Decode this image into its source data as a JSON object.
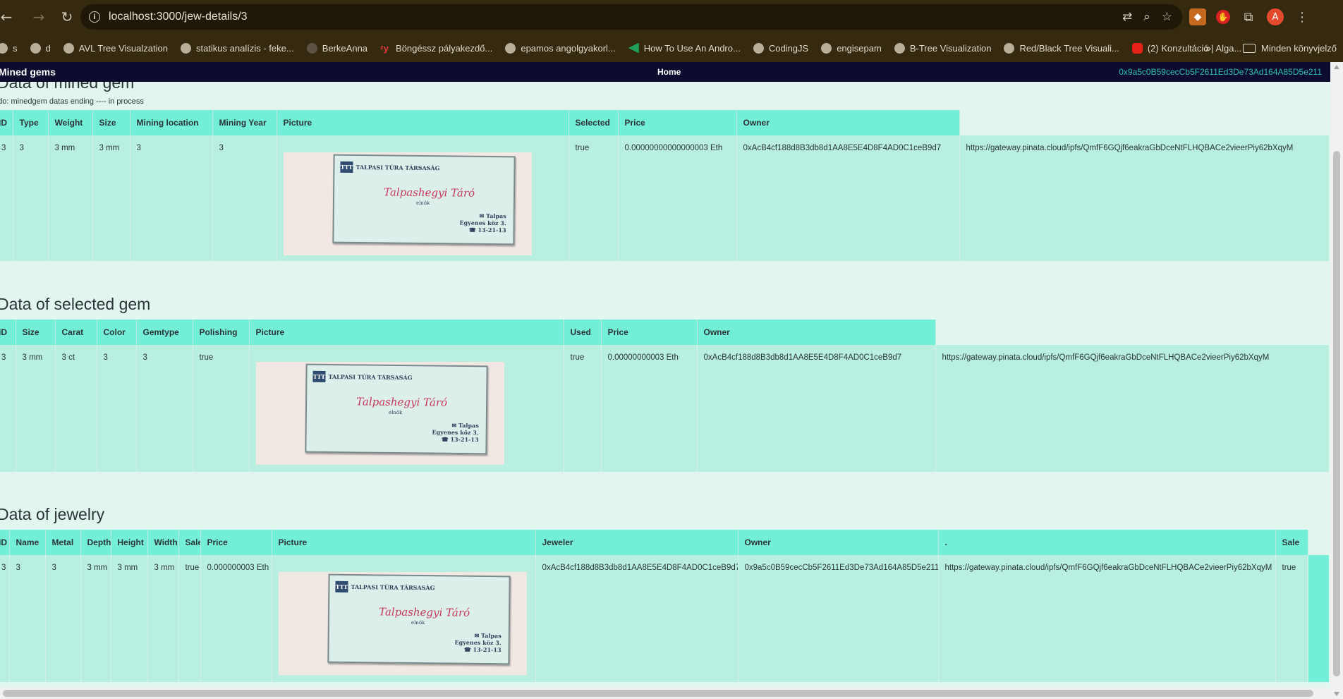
{
  "browser": {
    "url": "localhost:3000/jew-details/3",
    "bookmarks": [
      {
        "label": "s",
        "icon": "globe-icon"
      },
      {
        "label": "d",
        "icon": "globe-icon"
      },
      {
        "label": "AVL Tree Visualzation",
        "icon": "globe-icon"
      },
      {
        "label": "statikus analízis - feke...",
        "icon": "globe-icon"
      },
      {
        "label": "BerkeAnna",
        "icon": "github-icon"
      },
      {
        "label": "Böngéssz pályakezdő...",
        "icon": "zy-icon"
      },
      {
        "label": "epamos angolgyakorl...",
        "icon": "globe-icon"
      },
      {
        "label": "How To Use An Andro...",
        "icon": "arrow-icon"
      },
      {
        "label": "CodingJS",
        "icon": "globe-icon"
      },
      {
        "label": "engisepam",
        "icon": "globe-icon"
      },
      {
        "label": "B-Tree Visualization",
        "icon": "globe-icon"
      },
      {
        "label": "Red/Black Tree Visuali...",
        "icon": "globe-icon"
      },
      {
        "label": "(2) Konzultáció | Alga...",
        "icon": "youtube-icon"
      }
    ],
    "more_label": "»",
    "folder_label": "Minden könyvjelző",
    "avatar_letter": "A"
  },
  "navbar": {
    "brand": "Mined gems",
    "home": "Home",
    "account": "0x9a5c0B59cecCb5F2611Ed3De73Ad164A85D5e211"
  },
  "card_image": {
    "logo": "TTT",
    "org": "TALPASI TÚRA TÁRSASÁG",
    "name": "Talpashegyi Táró",
    "role": "elnök",
    "addr1": "✉ Talpas",
    "addr2": "Egyenes köz 3.",
    "addr3": "☎ 13-21-13"
  },
  "mined": {
    "title": "Data of mined gem",
    "note": "todo: minedgem datas ending ---- in process",
    "headers": [
      "ID",
      "Type",
      "Weight",
      "Size",
      "Mining location",
      "Mining Year",
      "Picture",
      "Selected",
      "Price",
      "Owner"
    ],
    "row": {
      "id": "3",
      "type": "3",
      "weight": "3 mm",
      "size": "3 mm",
      "location": "3",
      "year": "3",
      "selected": "true",
      "price": "0.00000000000000003 Eth",
      "owner": "0xAcB4cf188d8B3db8d1AA8E5E4D8F4AD0C1ceB9d7",
      "link": "https://gateway.pinata.cloud/ipfs/QmfF6GQjf6eakraGbDceNtFLHQBACe2vieerPiy62bXqyM"
    }
  },
  "selected": {
    "title": "Data of selected gem",
    "headers": [
      "ID",
      "Size",
      "Carat",
      "Color",
      "Gemtype",
      "Polishing",
      "Picture",
      "Used",
      "Price",
      "Owner"
    ],
    "row": {
      "id": "3",
      "size": "3 mm",
      "carat": "3 ct",
      "color": "3",
      "gemtype": "3",
      "polishing": "true",
      "used": "true",
      "price": "0.00000000003 Eth",
      "owner": "0xAcB4cf188d8B3db8d1AA8E5E4D8F4AD0C1ceB9d7",
      "link": "https://gateway.pinata.cloud/ipfs/QmfF6GQjf6eakraGbDceNtFLHQBACe2vieerPiy62bXqyM"
    }
  },
  "jewelry": {
    "title": "Data of jewelry",
    "headers": [
      "ID",
      "Name",
      "Metal",
      "Depth",
      "Height",
      "Width",
      "Sale",
      "Price",
      "Picture",
      "Jeweler",
      "Owner",
      ".",
      "Sale"
    ],
    "row": {
      "id": "3",
      "name": "3",
      "metal": "3",
      "depth": "3 mm",
      "height": "3 mm",
      "width": "3 mm",
      "sale": "true",
      "price": "0.000000003 Eth",
      "jeweler": "0xAcB4cf188d8B3db8d1AA8E5E4D8F4AD0C1ceB9d7",
      "owner": "0x9a5c0B59cecCb5F2611Ed3De73Ad164A85D5e211",
      "link": "https://gateway.pinata.cloud/ipfs/QmfF6GQjf6eakraGbDceNtFLHQBACe2vieerPiy62bXqyM",
      "sale2": "true"
    }
  }
}
